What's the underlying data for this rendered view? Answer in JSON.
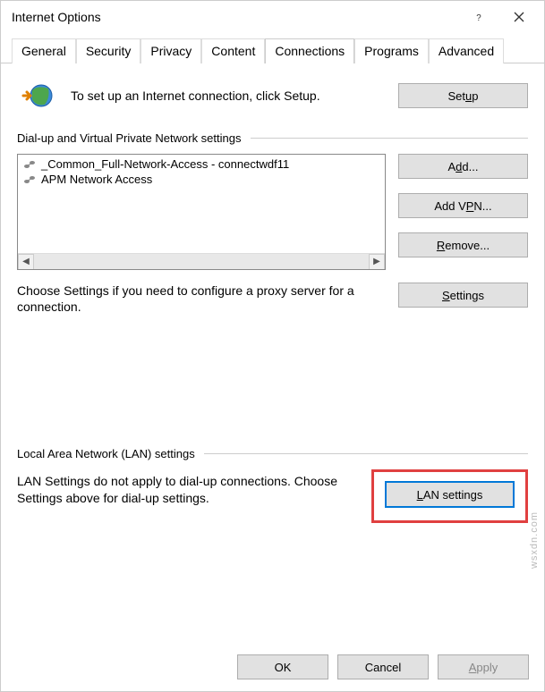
{
  "window": {
    "title": "Internet Options"
  },
  "tabs": [
    "General",
    "Security",
    "Privacy",
    "Content",
    "Connections",
    "Programs",
    "Advanced"
  ],
  "active_tab": "Connections",
  "intro": {
    "text": "To set up an Internet connection, click Setup.",
    "setup_btn": "Setup"
  },
  "dialup": {
    "group_label": "Dial-up and Virtual Private Network settings",
    "items": [
      "_Common_Full-Network-Access - connectwdf11",
      "APM Network Access"
    ],
    "add_btn": "Add...",
    "add_vpn_btn": "Add VPN...",
    "remove_btn": "Remove...",
    "settings_btn": "Settings",
    "choose_text": "Choose Settings if you need to configure a proxy server for a connection."
  },
  "lan": {
    "group_label": "Local Area Network (LAN) settings",
    "text": "LAN Settings do not apply to dial-up connections. Choose Settings above for dial-up settings.",
    "lan_btn": "LAN settings"
  },
  "footer": {
    "ok": "OK",
    "cancel": "Cancel",
    "apply": "Apply"
  },
  "watermark": "wsxdn.com"
}
